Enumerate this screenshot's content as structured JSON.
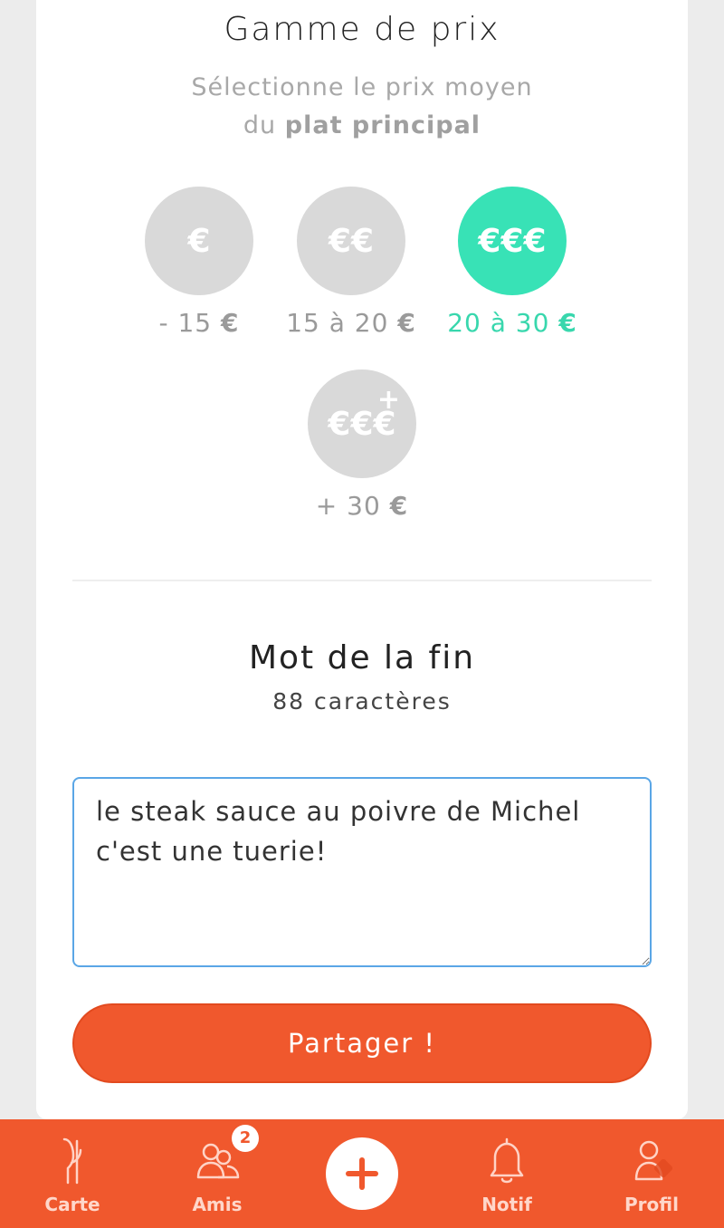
{
  "price": {
    "title": "Gamme de prix",
    "subtitle_line1": "Sélectionne le prix moyen",
    "subtitle_prefix": "du ",
    "subtitle_bold": "plat principal",
    "options": [
      {
        "symbol": "€",
        "label": "- 15",
        "eur": "€",
        "selected": false
      },
      {
        "symbol": "€€",
        "label": "15 à 20",
        "eur": "€",
        "selected": false
      },
      {
        "symbol": "€€€",
        "label": "20 à 30",
        "eur": "€",
        "selected": true
      },
      {
        "symbol": "€€€",
        "plus": "+",
        "label": "+ 30",
        "eur": "€",
        "selected": false
      }
    ]
  },
  "final_word": {
    "title": "Mot de la fin",
    "count": "88 caractères",
    "text": "le steak sauce au poivre de Michel c'est une tuerie!"
  },
  "share_label": "Partager !",
  "nav": {
    "items": [
      {
        "label": "Carte",
        "icon": "fork-icon"
      },
      {
        "label": "Amis",
        "icon": "friends-icon",
        "badge": "2"
      },
      {
        "label": "",
        "icon": "plus-icon"
      },
      {
        "label": "Notif",
        "icon": "bell-icon"
      },
      {
        "label": "Profil",
        "icon": "profile-icon"
      }
    ]
  },
  "colors": {
    "accent": "#f0582d",
    "selected": "#38e2b6",
    "unselected": "#d9d9d9"
  }
}
